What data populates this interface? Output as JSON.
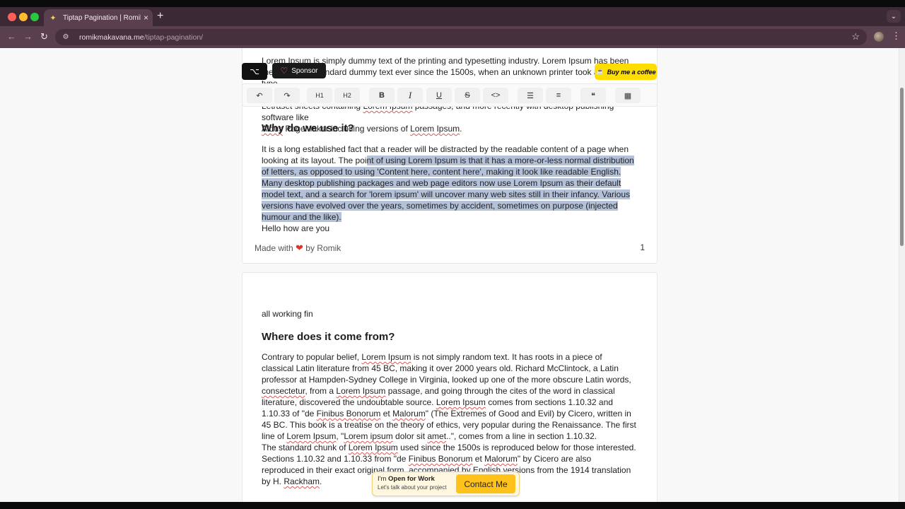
{
  "browser": {
    "tab_title": "Tiptap Pagination | Romik Ma",
    "url_host": "romikmakavana.me",
    "url_path": "/tiptap-pagination/"
  },
  "floating": {
    "sponsor_label": "Sponsor",
    "coffee_label": "Buy me a coffee"
  },
  "toolbar": {
    "h1": "H1",
    "h2": "H2",
    "bold": "B",
    "italic": "I",
    "underline": "U",
    "strike": "S",
    "code": "<>"
  },
  "page1": {
    "intro_top": "Lorem Ipsum is simply dummy text of the printing and typesetting industry. Lorem Ipsum has been the industry's standard dummy text ever since the 1500s, when an unknown printer took a galley of type",
    "intro_p1": "Letraset sheets containing ",
    "intro_u1": "Lorem Ipsum",
    "intro_p2": " passages, and more recently with desktop publishing software like",
    "intro_u2": "Aldus",
    "intro_p3": " PageMaker including versions of ",
    "intro_u3": "Lorem Ipsum",
    "intro_p4": ".",
    "heading": "Why do we use it?",
    "para_start": "It is a long established fact that a reader will be distracted by the readable content of a page when looking at its layout. The poi",
    "para_selected": "nt of using Lorem Ipsum is that it has a more-or-less normal distribution of letters, as opposed to using 'Content here, content here', making it look like readable English. Many desktop publishing packages and web page editors now use Lorem Ipsum as their default model text, and a search for 'lorem ipsum' will uncover many web sites still in their infancy. Various versions have evolved over the years, sometimes by accident, sometimes on purpose (injected humour and the like).",
    "hello": "Hello how are you",
    "footer_made": "Made with",
    "footer_by": "by Romik",
    "page_number": "1"
  },
  "page2": {
    "line1": "all working fin",
    "heading": "Where does it come from?",
    "s1": "Contrary to popular belief, ",
    "u1": "Lorem Ipsum",
    "s2": " is not simply random text. It has roots in a piece of classical Latin literature from 45 BC, making it over 2000 years old. Richard McClintock, a Latin professor at Hampden-Sydney College in Virginia, looked up one of the more obscure Latin words, ",
    "u2": "consectetur",
    "s3": ", from a ",
    "u3": "Lorem Ipsum",
    "s4": " passage, and going through the cites of the word in classical literature, discovered the undoubtable source. ",
    "u4": "Lorem Ipsum",
    "s5": " comes from sections 1.10.32 and 1.10.33 of \"de ",
    "u5": "Finibus Bonorum",
    "s6": " et ",
    "u6": "Malorum",
    "s7": "\" (The Extremes of Good and Evil) by Cicero, written in 45 BC. This book is a treatise on the theory of ethics, very popular during the Renaissance. The first line of ",
    "u7": "Lorem Ipsum",
    "s8": ", \"",
    "u8": "Lorem ipsum",
    "s9": " dolor sit ",
    "u9": "amet",
    "s10": "..\", comes from a line in section 1.10.32.",
    "t1": "The standard chunk of ",
    "tu1": "Lorem Ipsum",
    "t2": " used since the 1500s is reproduced below for those interested. Sections 1.10.32 and 1.10.33 from \"de ",
    "tu2": "Finibus Bonorum",
    "t3": " et ",
    "tu3": "Malorum",
    "t4": "\" by Cicero are also reproduced in their exact original form, accompanied by English versions from the 1914 translation by H. ",
    "tu4": "Rackham",
    "t5": "."
  },
  "contact": {
    "im": "I'm",
    "open": "Open for Work",
    "sub": "Let's talk about your project",
    "button": "Contact Me"
  }
}
